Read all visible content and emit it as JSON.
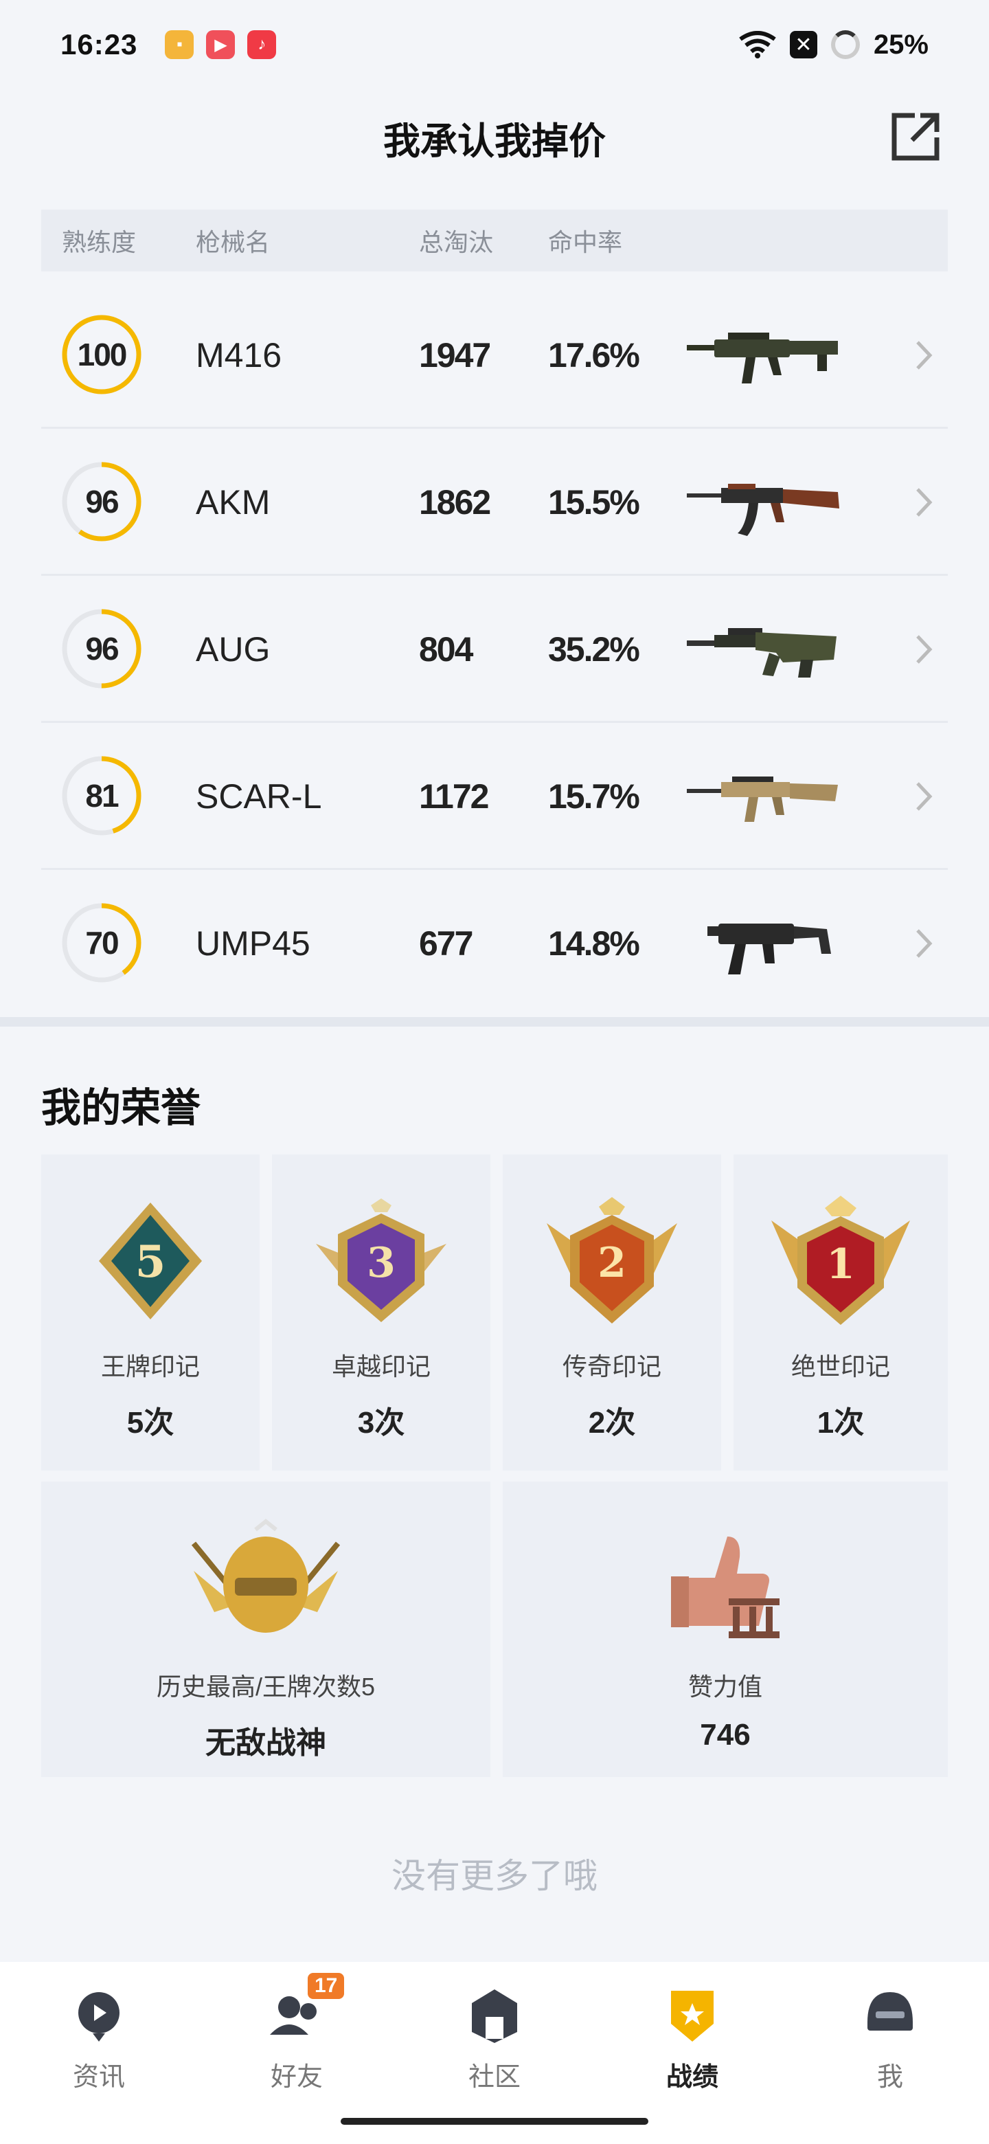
{
  "status_bar": {
    "time": "16:23",
    "battery": "25%"
  },
  "header": {
    "title": "我承认我掉价"
  },
  "table": {
    "columns": [
      "熟练度",
      "枪械名",
      "总淘汰",
      "命中率"
    ],
    "rows": [
      {
        "proficiency": "100",
        "progress": 1.0,
        "name": "M416",
        "kills": "1947",
        "hit_rate": "17.6%",
        "gun_icon": "m416-rifle-icon"
      },
      {
        "proficiency": "96",
        "progress": 0.6,
        "name": "AKM",
        "kills": "1862",
        "hit_rate": "15.5%",
        "gun_icon": "akm-rifle-icon"
      },
      {
        "proficiency": "96",
        "progress": 0.5,
        "name": "AUG",
        "kills": "804",
        "hit_rate": "35.2%",
        "gun_icon": "aug-rifle-icon"
      },
      {
        "proficiency": "81",
        "progress": 0.45,
        "name": "SCAR-L",
        "kills": "1172",
        "hit_rate": "15.7%",
        "gun_icon": "scar-l-rifle-icon"
      },
      {
        "proficiency": "70",
        "progress": 0.4,
        "name": "UMP45",
        "kills": "677",
        "hit_rate": "14.8%",
        "gun_icon": "ump45-smg-icon"
      }
    ]
  },
  "honors": {
    "title": "我的荣誉",
    "marks": [
      {
        "name": "王牌印记",
        "count": "5次",
        "medal_text": "5",
        "color": "#1e5a5c",
        "icon": "ace-mark-medal-icon"
      },
      {
        "name": "卓越印记",
        "count": "3次",
        "medal_text": "3",
        "color": "#6b3fa0",
        "icon": "excellence-mark-medal-icon"
      },
      {
        "name": "传奇印记",
        "count": "2次",
        "medal_text": "2",
        "color": "#c8501e",
        "icon": "legend-mark-medal-icon"
      },
      {
        "name": "绝世印记",
        "count": "1次",
        "medal_text": "1",
        "color": "#b01c24",
        "icon": "peerless-mark-medal-icon"
      }
    ],
    "highest": {
      "label": "历史最高/王牌次数5",
      "value": "无敌战神",
      "icon": "conqueror-helmet-icon"
    },
    "likes": {
      "label": "赞力值",
      "value": "746",
      "icon": "thumbs-up-icon"
    }
  },
  "footer_text": "没有更多了哦",
  "nav": {
    "items": [
      {
        "label": "资讯",
        "icon": "news-icon",
        "active": false
      },
      {
        "label": "好友",
        "icon": "friends-icon",
        "active": false,
        "badge": "17"
      },
      {
        "label": "社区",
        "icon": "community-icon",
        "active": false
      },
      {
        "label": "战绩",
        "icon": "record-icon",
        "active": true
      },
      {
        "label": "我",
        "icon": "profile-helmet-icon",
        "active": false
      }
    ]
  }
}
